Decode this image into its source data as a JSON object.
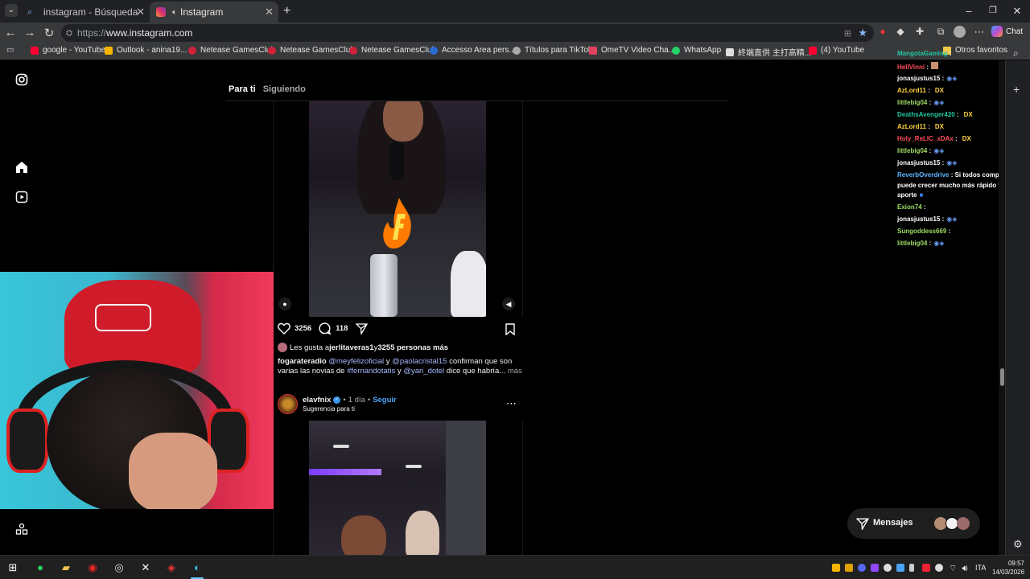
{
  "browser": {
    "tabs": [
      {
        "label": "instagram - Búsqueda",
        "active": false
      },
      {
        "label": "Instagram",
        "active": true
      }
    ],
    "url_scheme": "https://",
    "url_domain": "www.instagram.com",
    "chat_button_label": "Chat",
    "bookmarks": [
      {
        "label": "google - YouTube",
        "color": "#ff0033"
      },
      {
        "label": "Outlook - anina19...",
        "color": "#f7b500"
      },
      {
        "label": "Netease GamesClub",
        "color": "#d1213b"
      },
      {
        "label": "Netease GamesClub",
        "color": "#d1213b"
      },
      {
        "label": "Netease GamesClub",
        "color": "#d1213b"
      },
      {
        "label": "Accesso Area pers...",
        "color": "#2b6cd4"
      },
      {
        "label": "Títulos para TikTok",
        "color": "#aaaaaa"
      },
      {
        "label": "OmeTV Video Cha...",
        "color": "#e3425f"
      },
      {
        "label": "WhatsApp",
        "color": "#25d366"
      },
      {
        "label": "終端直供 主打高精...",
        "color": "#dddddd"
      },
      {
        "label": "(4) YouTube",
        "color": "#ff0033"
      }
    ],
    "other_favorites": "Otros favoritos"
  },
  "feed": {
    "tabs": [
      "Para ti",
      "Siguiendo"
    ]
  },
  "post1": {
    "likes": "3256",
    "comments": "118",
    "liked_by_prefix": "Les gusta a ",
    "liked_by_user": "jerlitaveras1",
    "liked_by_mid": " y ",
    "liked_by_rest": "3255 personas más",
    "author": "fogarateradio",
    "caption_line1_a": "@meyfelizoficial",
    "caption_line1_b": " y ",
    "caption_line1_c": "@paolacristal15",
    "caption_line1_d": " confirman que son",
    "caption_line2_a": "varias las novias de ",
    "caption_line2_b": "#fernandotatis",
    "caption_line2_c": " y ",
    "caption_line2_d": "@yari_dotel",
    "caption_line2_e": " dice que habría...",
    "more": "más"
  },
  "post2": {
    "author": "elavfnix",
    "dot": "•",
    "time": "1 día",
    "follow": "Seguir",
    "subtitle": "Sugerencia para ti",
    "more_icon": "⋯"
  },
  "chat": {
    "lines": [
      {
        "user": "MangotaGaming",
        "text": " :",
        "cls": "u"
      },
      {
        "user": "HellVinni",
        "text": " :",
        "cls": "ur"
      },
      {
        "user": "jonasjustus15",
        "text": " :",
        "cls": "t"
      },
      {
        "user": "AzLord11",
        "text": " :",
        "cls": "uy",
        "suffix": "DX"
      },
      {
        "user": "littlebig04",
        "text": " :",
        "cls": "u"
      },
      {
        "user": "DeathsAvenger420",
        "text": " :",
        "cls": "u",
        "suffix": "DX"
      },
      {
        "user": "AzLord11",
        "text": " :",
        "cls": "uy",
        "suffix": "DX"
      },
      {
        "user": "Holy_ReLIC_xDAx",
        "text": " :",
        "cls": "ur",
        "suffix": "DX"
      },
      {
        "user": "littlebig04",
        "text": " :",
        "cls": "u"
      },
      {
        "user": "jonasjustus15",
        "text": " :",
        "cls": "t"
      },
      {
        "user": "ReverbOverdrive",
        "text": " : Si todos compartimos el l",
        "cls": "ub"
      },
      {
        "user": "",
        "text": "puede crecer mucho más rápido y llegar a ger",
        "cls": "t"
      },
      {
        "user": "",
        "text": "aporte",
        "cls": "t"
      },
      {
        "user": "Exion74",
        "text": " :",
        "cls": "u"
      },
      {
        "user": "jonasjustus15",
        "text": " :",
        "cls": "t"
      },
      {
        "user": "Sungoddess669",
        "text": " :",
        "cls": "u"
      },
      {
        "user": "littlebig04",
        "text": " :",
        "cls": "u"
      }
    ]
  },
  "messages": {
    "label": "Mensajes"
  },
  "taskbar": {
    "lang": "ITA",
    "time": "09:57",
    "date": "14/03/2026"
  }
}
